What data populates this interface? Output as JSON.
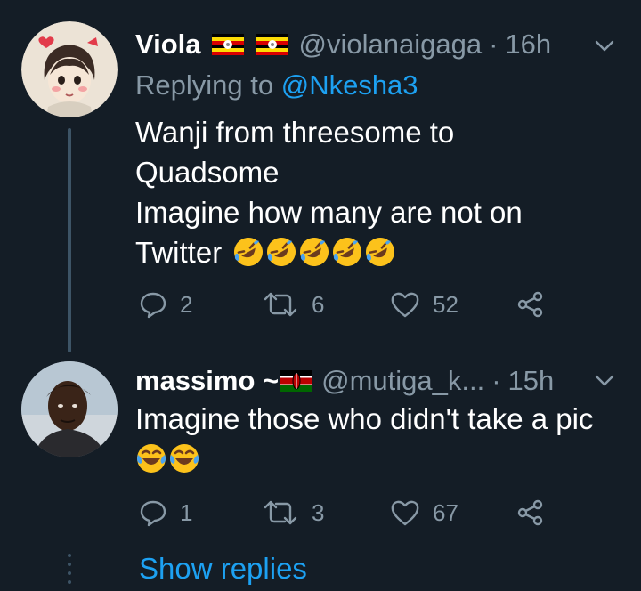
{
  "tweets": [
    {
      "name": "Viola",
      "handle": "@violanaigaga",
      "sep": "·",
      "time": "16h",
      "flags": [
        "uganda-flag",
        "uganda-flag"
      ],
      "replying_prefix": "Replying to",
      "replying_mention": "@Nkesha3",
      "lines": [
        "Wanji from threesome to",
        "Quadsome",
        "Imagine how many are not on",
        "Twitter"
      ],
      "trailing_emoji": "rolling-on-floor-laughing-emoji",
      "trailing_emoji_count": 5,
      "reply_count": "2",
      "retweet_count": "6",
      "like_count": "52"
    },
    {
      "name": "massimo ~",
      "handle": "@mutiga_k...",
      "sep": "·",
      "time": "15h",
      "flags": [
        "kenya-flag"
      ],
      "lines": [
        "Imagine those who didn't take a pic"
      ],
      "trailing_emoji": "face-with-tears-of-joy-emoji",
      "trailing_emoji_count": 2,
      "reply_count": "1",
      "retweet_count": "3",
      "like_count": "67"
    }
  ],
  "show_replies_label": "Show replies",
  "colors": {
    "background": "#141d26",
    "secondary_text": "#8899a6",
    "accent": "#1da1f2",
    "thread_line": "#3d5466"
  }
}
